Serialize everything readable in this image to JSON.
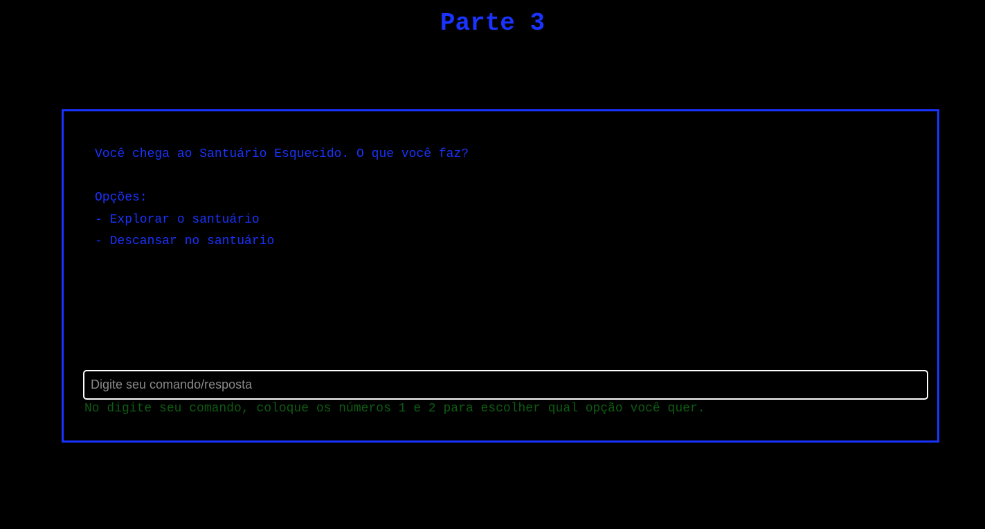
{
  "page": {
    "title": "Parte 3"
  },
  "game": {
    "output_lines": [
      "Você chega ao Santuário Esquecido. O que você faz?",
      "",
      "Opções:",
      "- Explorar o santuário",
      "- Descansar no santuário"
    ],
    "input": {
      "value": "",
      "placeholder": "Digite seu comando/resposta"
    },
    "hint": "No digite seu comando, coloque os números 1 e 2 para escolher qual opção você quer."
  },
  "colors": {
    "background": "#000000",
    "accent_blue": "#1a33ff",
    "hint_green": "#0d5c12",
    "input_border": "#ffffff"
  }
}
